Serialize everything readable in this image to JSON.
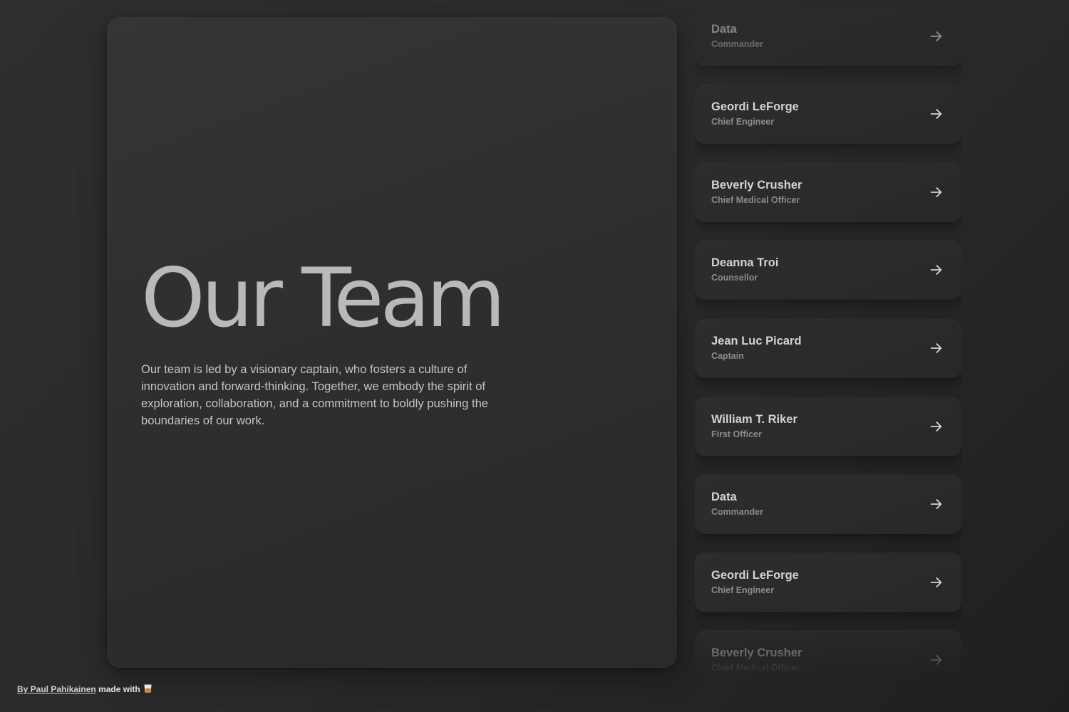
{
  "hero": {
    "title": "Our Team",
    "description": "Our team is led by a visionary captain, who fosters a culture of innovation and forward-thinking. Together, we embody the spirit of exploration, collaboration, and a commitment to boldly pushing the boundaries of our work."
  },
  "team": {
    "members": [
      {
        "name": "Data",
        "role": "Commander",
        "icon": "arrow-right-icon"
      },
      {
        "name": "Geordi LeForge",
        "role": "Chief Engineer",
        "icon": "arrow-right-icon"
      },
      {
        "name": "Beverly Crusher",
        "role": "Chief Medical Officer",
        "icon": "arrow-right-icon"
      },
      {
        "name": "Deanna Troi",
        "role": "Counsellor",
        "icon": "arrow-right-icon"
      },
      {
        "name": "Jean Luc Picard",
        "role": "Captain",
        "icon": "arrow-right-icon"
      },
      {
        "name": "William T. Riker",
        "role": "First Officer",
        "icon": "arrow-right-icon"
      },
      {
        "name": "Data",
        "role": "Commander",
        "icon": "arrow-right-icon"
      },
      {
        "name": "Geordi LeForge",
        "role": "Chief Engineer",
        "icon": "arrow-right-icon"
      },
      {
        "name": "Beverly Crusher",
        "role": "Chief Medical Officer",
        "icon": "arrow-right-icon"
      }
    ]
  },
  "footer": {
    "author_link": "By Paul Pahikainen",
    "made_with": "made with",
    "icon": "whisky-glass-icon"
  },
  "colors": {
    "background": "#2a2a2a",
    "card": "#303030",
    "title_text": "#b9b9b9",
    "name_text": "#d3d3d3",
    "role_text": "#8c8c8c"
  }
}
